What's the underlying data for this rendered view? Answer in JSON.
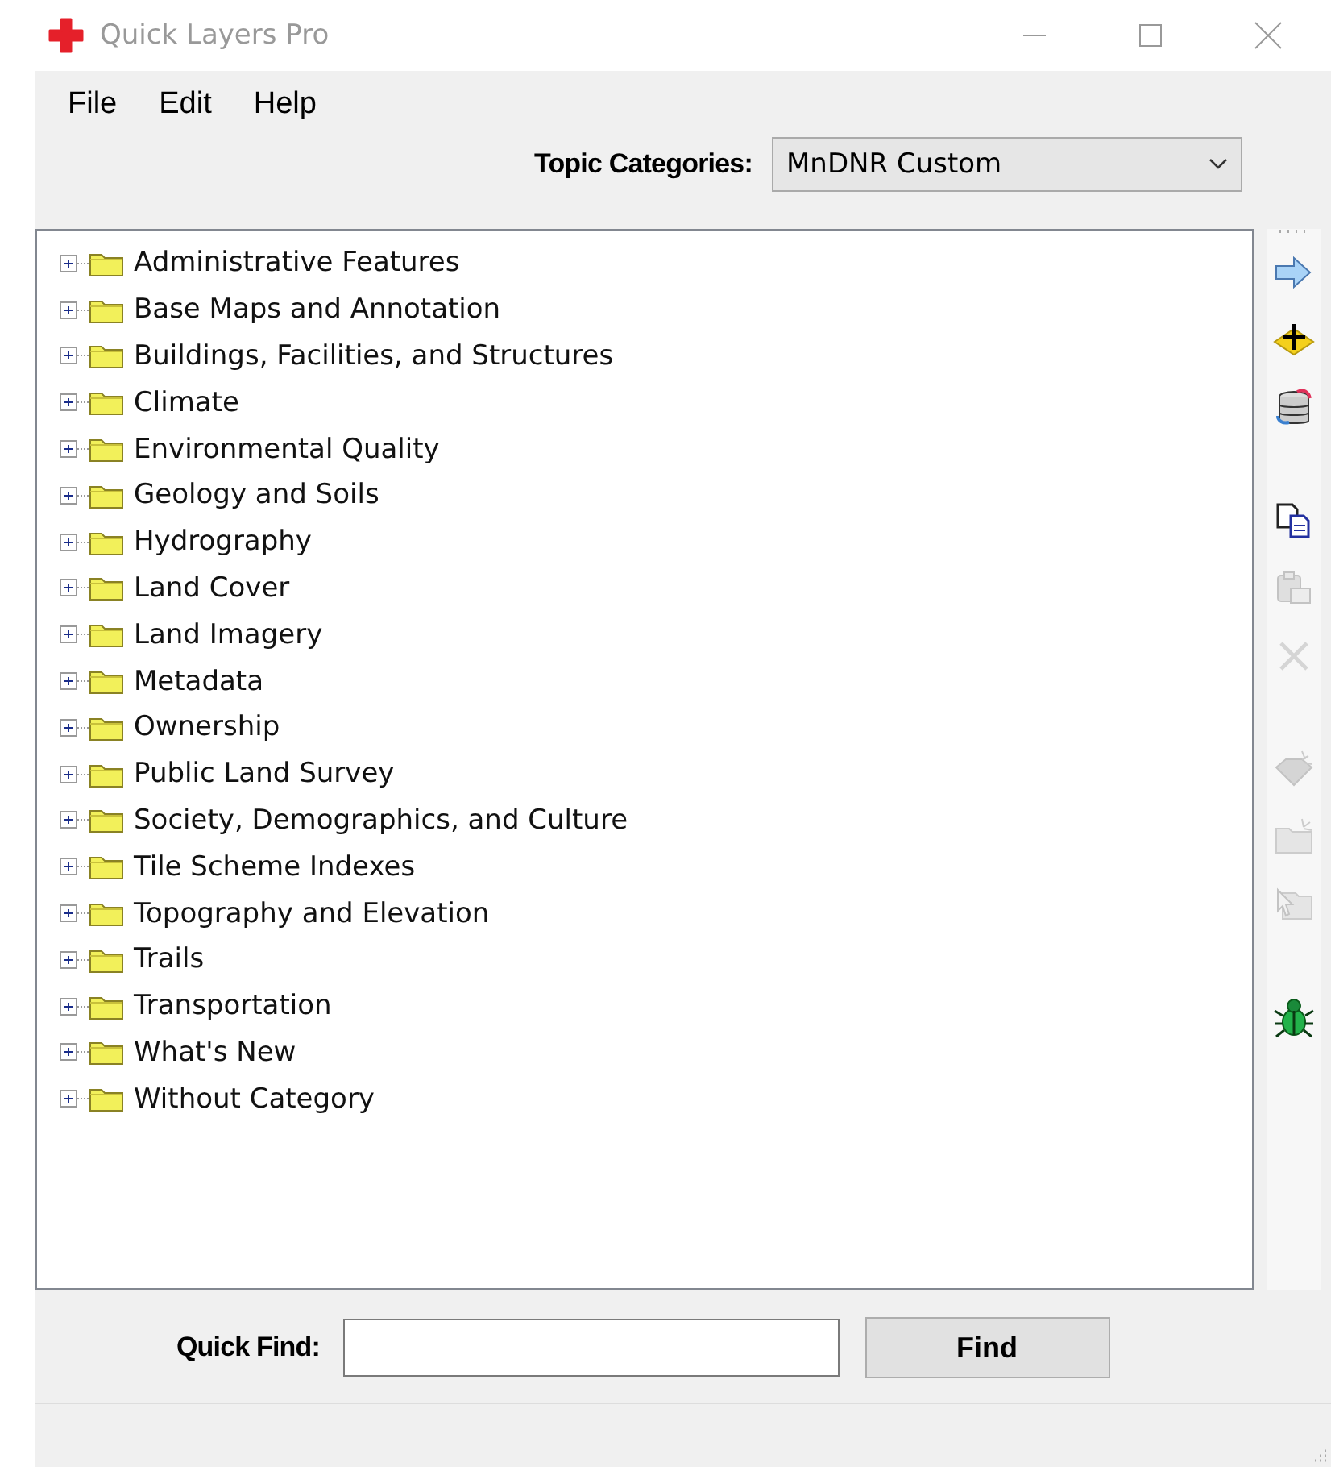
{
  "window": {
    "title": "Quick Layers Pro"
  },
  "menu": [
    "File",
    "Edit",
    "Help"
  ],
  "topic_categories": {
    "label": "Topic Categories:",
    "value": "MnDNR Custom"
  },
  "tree": [
    {
      "label": "Administrative Features",
      "expanded": false
    },
    {
      "label": "Base Maps and Annotation",
      "expanded": false
    },
    {
      "label": "Buildings, Facilities, and Structures",
      "expanded": false
    },
    {
      "label": "Climate",
      "expanded": false
    },
    {
      "label": "Environmental Quality",
      "expanded": false
    },
    {
      "label": "Geology and Soils",
      "expanded": false
    },
    {
      "label": "Hydrography",
      "expanded": false
    },
    {
      "label": "Land Cover",
      "expanded": false
    },
    {
      "label": "Land Imagery",
      "expanded": false
    },
    {
      "label": "Metadata",
      "expanded": false
    },
    {
      "label": "Ownership",
      "expanded": false
    },
    {
      "label": "Public Land Survey",
      "expanded": false
    },
    {
      "label": "Society, Demographics, and Culture",
      "expanded": false
    },
    {
      "label": "Tile Scheme Indexes",
      "expanded": false
    },
    {
      "label": "Topography and Elevation",
      "expanded": false
    },
    {
      "label": "Trails",
      "expanded": false
    },
    {
      "label": "Transportation",
      "expanded": false
    },
    {
      "label": "What's New",
      "expanded": false
    },
    {
      "label": "Without Category",
      "expanded": false
    }
  ],
  "toolbar_groups": [
    [
      {
        "kind": "arrow",
        "disabled": false
      },
      {
        "kind": "add",
        "disabled": false
      },
      {
        "kind": "database",
        "disabled": false
      }
    ],
    [
      {
        "kind": "copy",
        "disabled": false
      },
      {
        "kind": "paste",
        "disabled": true
      },
      {
        "kind": "delete",
        "disabled": true
      }
    ],
    [
      {
        "kind": "gem",
        "disabled": true
      },
      {
        "kind": "folder-new",
        "disabled": true
      },
      {
        "kind": "folder-pointer",
        "disabled": true
      }
    ],
    [
      {
        "kind": "bug",
        "disabled": false
      }
    ]
  ],
  "quick_find": {
    "label": "Quick Find:",
    "button": "Find"
  }
}
